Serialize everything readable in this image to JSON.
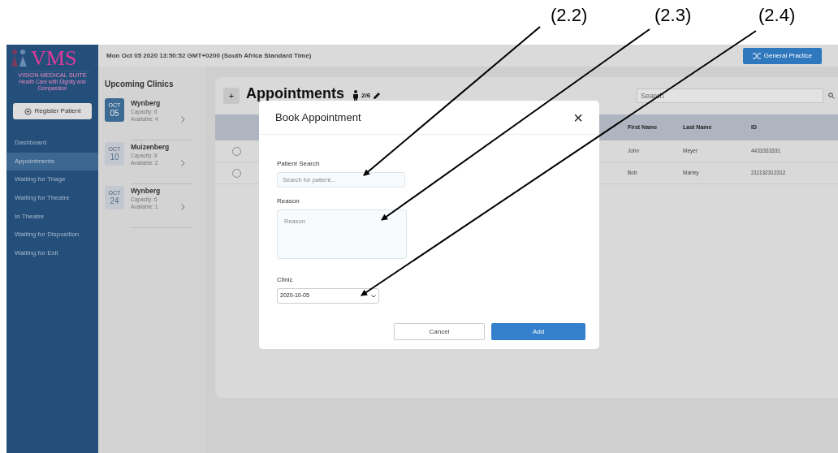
{
  "annotations": [
    {
      "label": "(2.2)"
    },
    {
      "label": "(2.3)"
    },
    {
      "label": "(2.4)"
    }
  ],
  "logo": {
    "title": "VMS",
    "subtitle": "VISION MEDICAL SUITE",
    "tagline": "Health Care with Dignity and Compassion"
  },
  "header": {
    "datetime": "Mon Oct 05 2020 13:50:52 GMT+0200 (South Africa Standard Time)",
    "practice_button": "General Practice"
  },
  "sidebar": {
    "register_button": "Register Patient",
    "items": [
      {
        "label": "Dashboard",
        "selected": false
      },
      {
        "label": "Appointments",
        "selected": true
      },
      {
        "label": "Waiting for Triage",
        "selected": false
      },
      {
        "label": "Waiting for Theatre",
        "selected": false
      },
      {
        "label": "In Theatre",
        "selected": false
      },
      {
        "label": "Waiting for Disposition",
        "selected": false
      },
      {
        "label": "Waiting for Exit",
        "selected": false
      }
    ]
  },
  "clinics": {
    "title": "Upcoming Clinics",
    "items": [
      {
        "month": "OCT",
        "day": "05",
        "name": "Wynberg",
        "capacity": "Capacity: 6",
        "available": "Available: 4",
        "selected": true
      },
      {
        "month": "OCT",
        "day": "10",
        "name": "Muizenberg",
        "capacity": "Capacity: 8",
        "available": "Available: 2",
        "selected": false
      },
      {
        "month": "OCT",
        "day": "24",
        "name": "Wynberg",
        "capacity": "Capacity: 6",
        "available": "Available: 1",
        "selected": false
      }
    ]
  },
  "appointments": {
    "title": "Appointments",
    "plus": "+",
    "count": "2/6",
    "search_placeholder": "Search",
    "columns": [
      "First Name",
      "Last Name",
      "ID"
    ],
    "rows": [
      {
        "selected": false,
        "cells": [
          "John",
          "Meyer",
          "4433333331"
        ]
      },
      {
        "selected": false,
        "cells": [
          "Bob",
          "Marley",
          "211132312312"
        ]
      }
    ]
  },
  "dialog": {
    "title": "Book Appointment",
    "close": "×",
    "patient_label": "Patient Search",
    "patient_placeholder": "Search for patient...",
    "reason_label": "Reason",
    "reason_placeholder": "Reason",
    "clinic_label": "Clinic",
    "clinic_value": "2020-10-05",
    "buttons": [
      {
        "label": "Cancel",
        "kind": "secondary"
      },
      {
        "label": "Add",
        "kind": "primary"
      }
    ]
  }
}
